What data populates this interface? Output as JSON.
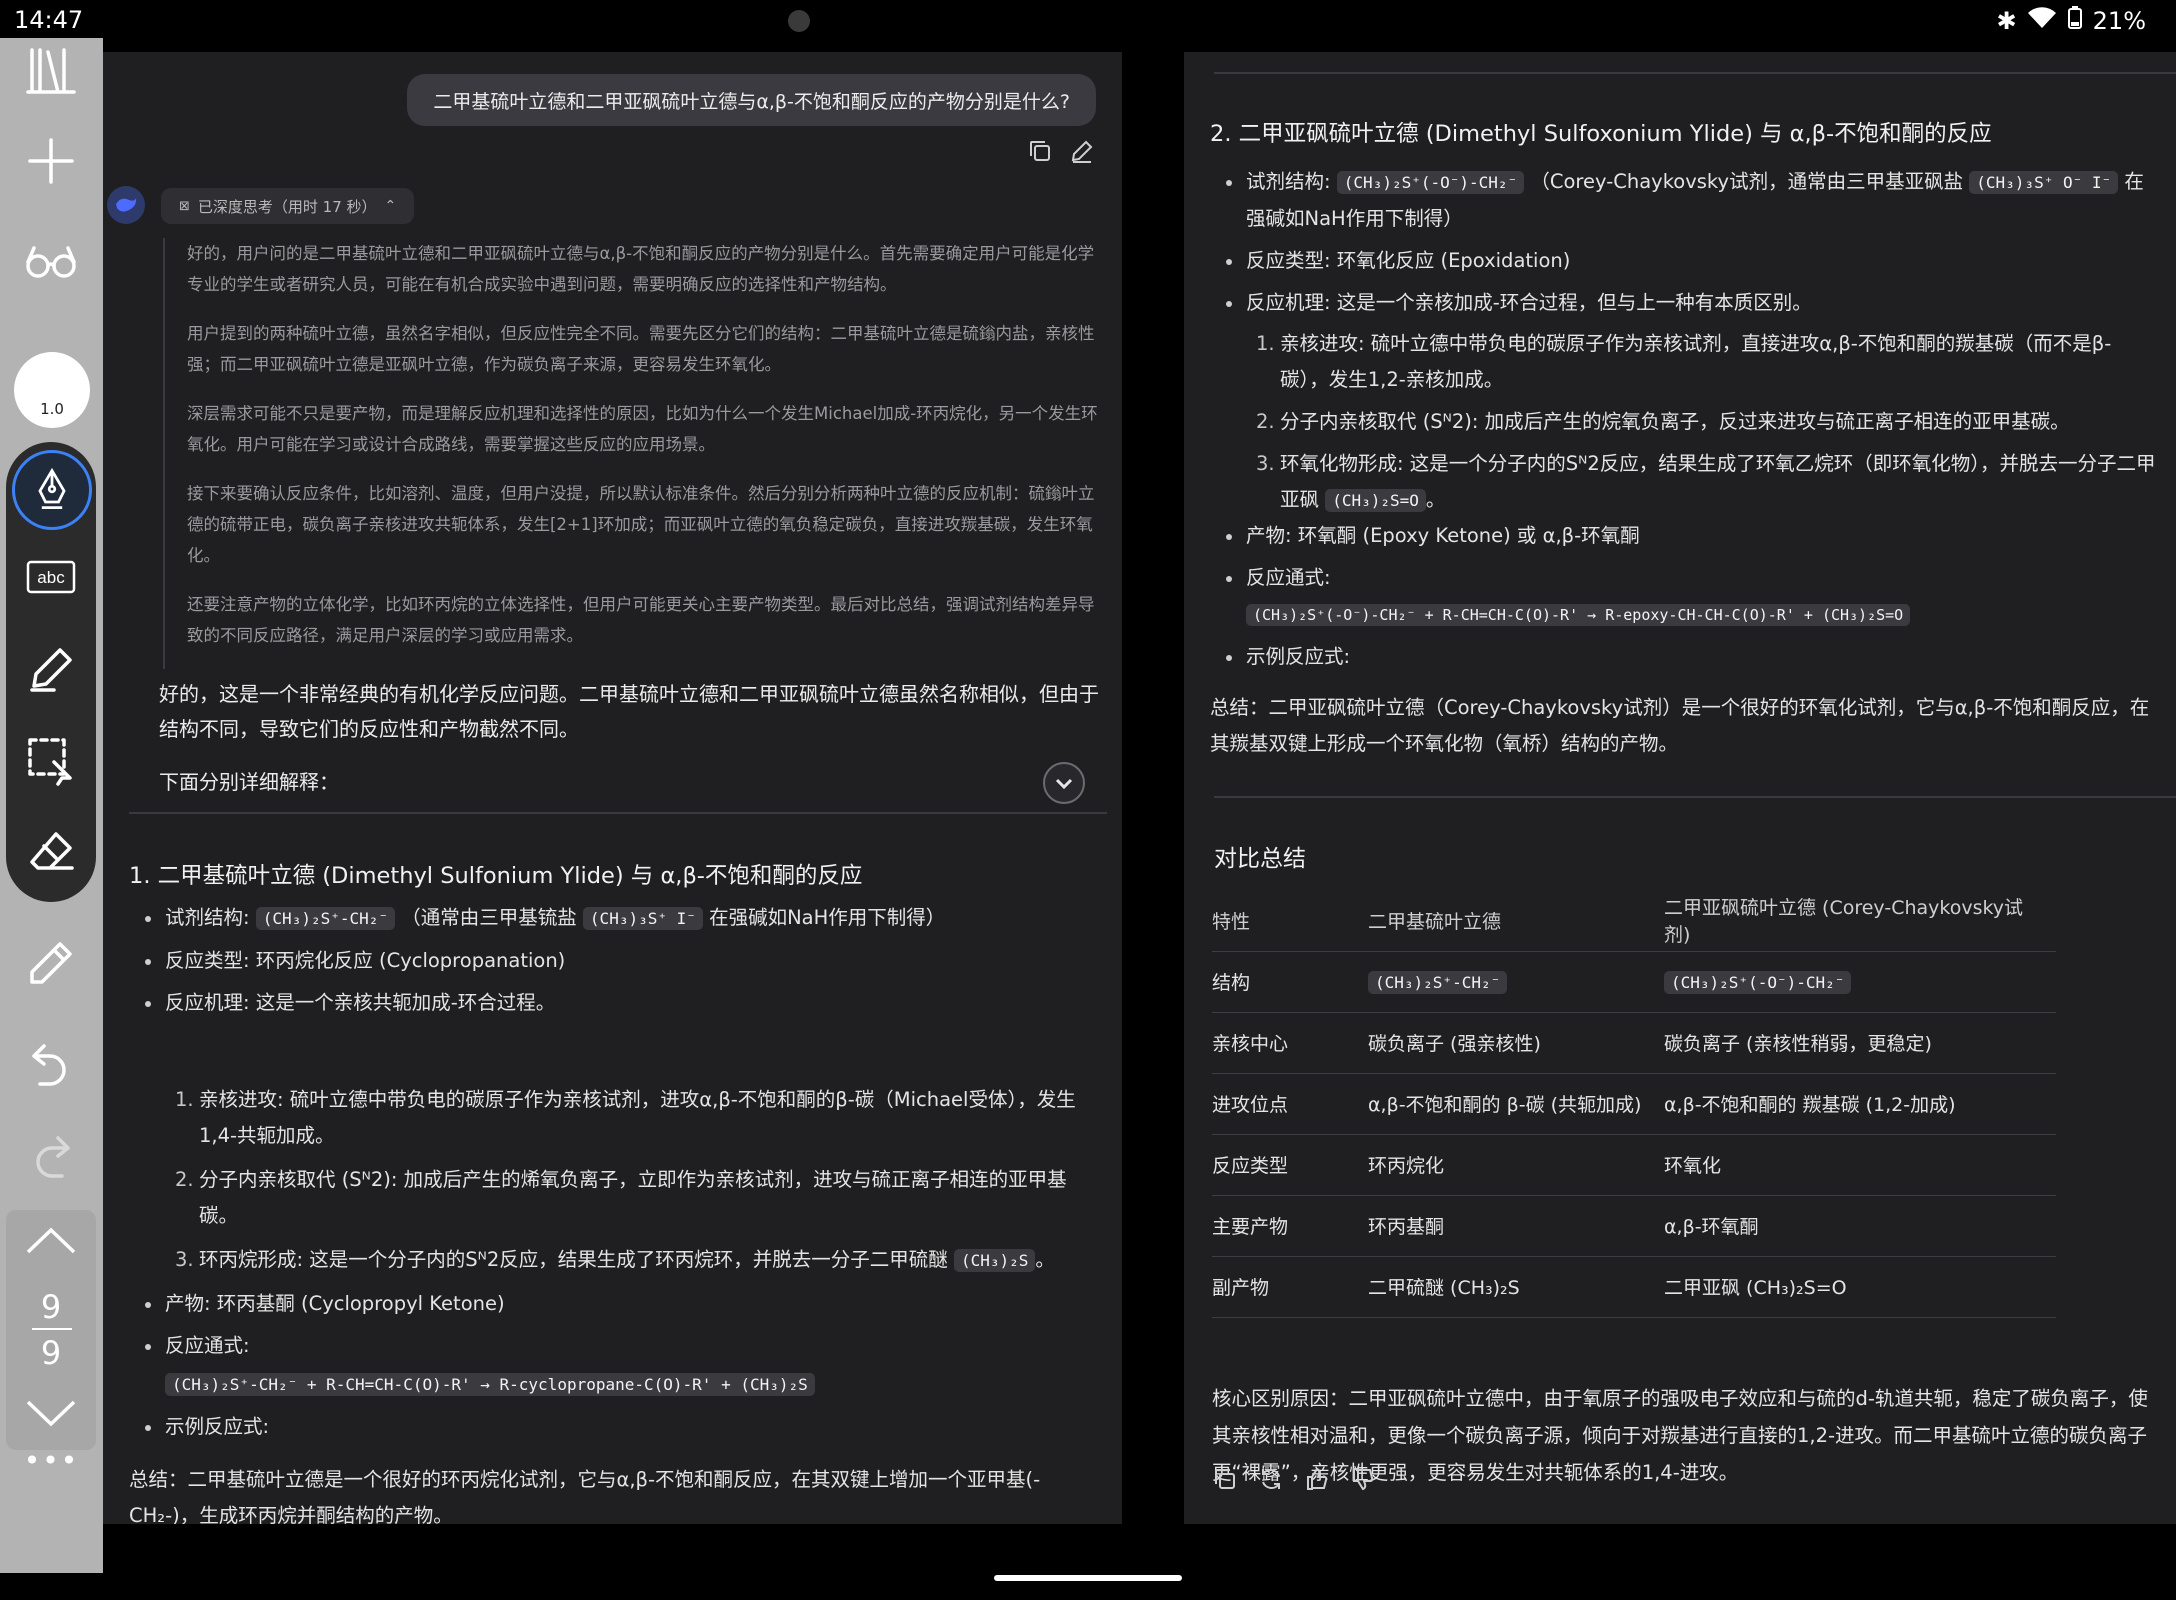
{
  "status": {
    "time": "14:47",
    "battery": "21%"
  },
  "toolbar": {
    "zoom_label": "1.0",
    "page_current": "9",
    "page_total": "9",
    "more_label": "•••"
  },
  "left": {
    "user_question": "二甲基硫叶立德和二甲亚砜硫叶立德与α,β-不饱和酮反应的产物分别是什么?",
    "thinking_label": "已深度思考（用时 17 秒）",
    "thinking": [
      "好的，用户问的是二甲基硫叶立德和二甲亚砜硫叶立德与α,β-不饱和酮反应的产物分别是什么。首先需要确定用户可能是化学专业的学生或者研究人员，可能在有机合成实验中遇到问题，需要明确反应的选择性和产物结构。",
      "用户提到的两种硫叶立德，虽然名字相似，但反应性完全不同。需要先区分它们的结构：二甲基硫叶立德是硫鎓内盐，亲核性强；而二甲亚砜硫叶立德是亚砜叶立德，作为碳负离子来源，更容易发生环氧化。",
      "深层需求可能不只是要产物，而是理解反应机理和选择性的原因，比如为什么一个发生Michael加成-环丙烷化，另一个发生环氧化。用户可能在学习或设计合成路线，需要掌握这些反应的应用场景。",
      "接下来要确认反应条件，比如溶剂、温度，但用户没提，所以默认标准条件。然后分别分析两种叶立德的反应机制：硫鎓叶立德的硫带正电，碳负离子亲核进攻共轭体系，发生[2+1]环加成；而亚砜叶立德的氧负稳定碳负，直接进攻羰基碳，发生环氧化。",
      "还要注意产物的立体化学，比如环丙烷的立体选择性，但用户可能更关心主要产物类型。最后对比总结，强调试剂结构差异导致的不同反应路径，满足用户深层的学习或应用需求。"
    ],
    "answer_intro": "好的，这是一个非常经典的有机化学反应问题。二甲基硫叶立德和二甲亚砜硫叶立德虽然名称相似，但由于结构不同，导致它们的反应性和产物截然不同。",
    "answer_sub": "下面分别详细解释：",
    "s1": {
      "title": "1. 二甲基硫叶立德 (Dimethyl Sulfonium Ylide) 与 α,β-不饱和酮的反应",
      "reagent_label": "试剂结构: ",
      "reagent_code": "(CH₃)₂S⁺-CH₂⁻",
      "reagent_mid": " （通常由三甲基锍盐 ",
      "reagent_code2": "(CH₃)₃S⁺ I⁻",
      "reagent_end": " 在强碱如NaH作用下制得）",
      "type": "反应类型: 环丙烷化反应 (Cyclopropanation)",
      "mech": "反应机理: 这是一个亲核共轭加成-环合过程。",
      "step1": "亲核进攻: 硫叶立德中带负电的碳原子作为亲核试剂，进攻α,β-不饱和酮的β-碳（Michael受体），发生1,4-共轭加成。",
      "step2": "分子内亲核取代 (Sᴺ2): 加成后产生的烯氧负离子，立即作为亲核试剂，进攻与硫正离子相连的亚甲基碳。",
      "step3_text": "环丙烷形成: 这是一个分子内的Sᴺ2反应，结果生成了环丙烷环，并脱去一分子二甲硫醚 ",
      "step3_code": "(CH₃)₂S",
      "step3_end": "。",
      "product": "产物: 环丙基酮 (Cyclopropyl Ketone)",
      "eq_label": "反应通式:",
      "eq_code": "(CH₃)₂S⁺-CH₂⁻ + R-CH=CH-C(O)-R' → R-cyclopropane-C(O)-R' + (CH₃)₂S",
      "example": "示例反应式:",
      "summary": "总结：二甲基硫叶立德是一个很好的环丙烷化试剂，它与α,β-不饱和酮反应，在其双键上增加一个亚甲基(-CH₂-)，生成环丙烷并酮结构的产物。"
    }
  },
  "right": {
    "s2": {
      "title": "2. 二甲亚砜硫叶立德 (Dimethyl Sulfoxonium Ylide) 与 α,β-不饱和酮的反应",
      "reagent_label": "试剂结构: ",
      "reagent_code": "(CH₃)₂S⁺(-O⁻)-CH₂⁻",
      "reagent_mid": " （Corey-Chaykovsky试剂，通常由三甲基亚砜盐 ",
      "reagent_code2": "(CH₃)₃S⁺ O⁻ I⁻",
      "reagent_end": " 在强碱如NaH作用下制得）",
      "type": "反应类型: 环氧化反应 (Epoxidation)",
      "mech": "反应机理: 这是一个亲核加成-环合过程，但与上一种有本质区别。",
      "step1": "亲核进攻: 硫叶立德中带负电的碳原子作为亲核试剂，直接进攻α,β-不饱和酮的羰基碳（而不是β-碳），发生1,2-亲核加成。",
      "step2": "分子内亲核取代 (Sᴺ2): 加成后产生的烷氧负离子，反过来进攻与硫正离子相连的亚甲基碳。",
      "step3_text": "环氧化物形成: 这是一个分子内的Sᴺ2反应，结果生成了环氧乙烷环（即环氧化物），并脱去一分子二甲亚砜 ",
      "step3_code": "(CH₃)₂S=O",
      "step3_end": "。",
      "product": "产物: 环氧酮 (Epoxy Ketone) 或 α,β-环氧酮",
      "eq_label": "反应通式:",
      "eq_code": "(CH₃)₂S⁺(-O⁻)-CH₂⁻ + R-CH=CH-C(O)-R' → R-epoxy-CH-CH-C(O)-R' + (CH₃)₂S=O",
      "example": "示例反应式:",
      "summary": "总结：二甲亚砜硫叶立德（Corey-Chaykovsky试剂）是一个很好的环氧化试剂，它与α,β-不饱和酮反应，在其羰基双键上形成一个环氧化物（氧桥）结构的产物。"
    },
    "compare_title": "对比总结",
    "table": {
      "header": [
        "特性",
        "二甲基硫叶立德",
        "二甲亚砜硫叶立德 (Corey-Chaykovsky试剂)"
      ],
      "rows": [
        [
          "结构",
          "(CH₃)₂S⁺-CH₂⁻",
          "(CH₃)₂S⁺(-O⁻)-CH₂⁻"
        ],
        [
          "亲核中心",
          "碳负离子 (强亲核性)",
          "碳负离子 (亲核性稍弱，更稳定)"
        ],
        [
          "进攻位点",
          "α,β-不饱和酮的 β-碳 (共轭加成)",
          "α,β-不饱和酮的 羰基碳 (1,2-加成)"
        ],
        [
          "反应类型",
          "环丙烷化",
          "环氧化"
        ],
        [
          "主要产物",
          "环丙基酮",
          "α,β-环氧酮"
        ],
        [
          "副产物",
          "二甲硫醚 (CH₃)₂S",
          "二甲亚砜 (CH₃)₂S=O"
        ]
      ]
    },
    "core_reason": "核心区别原因：二甲亚砜硫叶立德中，由于氧原子的强吸电子效应和与硫的d-轨道共轭，稳定了碳负离子，使其亲核性相对温和，更像一个碳负离子源，倾向于对羰基进行直接的1,2-进攻。而二甲基硫叶立德的碳负离子更“裸露”，亲核性更强，更容易发生对共轭体系的1,4-进攻。"
  }
}
